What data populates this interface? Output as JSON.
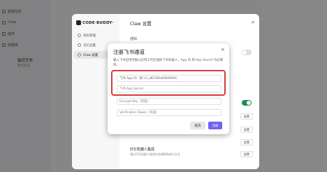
{
  "app_sidebar": {
    "items": [
      {
        "label": "新建任务",
        "icon": "new-task-icon"
      },
      {
        "label": "Claw",
        "icon": "claw-icon"
      },
      {
        "label": "插件",
        "icon": "plugin-icon"
      },
      {
        "label": "技能库",
        "icon": "skills-icon"
      }
    ],
    "group_title": "最近任务",
    "group_empty": "暂无任务"
  },
  "settings": {
    "logo": "CODE·BUDDY·",
    "title": "Claw 设置",
    "close": "×",
    "nav": [
      {
        "label": "身份管理",
        "icon": "identity-icon"
      },
      {
        "label": "记忆设置",
        "icon": "memory-icon"
      },
      {
        "label": "Claw 设置",
        "icon": "claw-settings-icon"
      }
    ],
    "section_notify": "通知",
    "section_bot_title": "钉钉机器人集成",
    "section_bot_desc": "通过钉钉机器人接收任务通知和进行交互",
    "config_label": "配置",
    "toggles": [
      false,
      true
    ]
  },
  "dialog": {
    "title": "注册飞书通道",
    "close": "×",
    "description": "输入飞书应用凭据以启用工作区通知飞书机器人。App ID 和 App Secret 为必填项。",
    "fields": [
      {
        "value": "飞书 App ID（如 cli_a82360a69b69d4）",
        "placeholder": "飞书 App ID"
      },
      {
        "value": "",
        "placeholder": "飞书 App Secret"
      },
      {
        "value": "",
        "placeholder": "Encrypt Key（可选）"
      },
      {
        "value": "",
        "placeholder": "Verification Token（可选）"
      }
    ],
    "cancel_label": "取消",
    "save_label": "注册"
  },
  "colors": {
    "accent": "#6c63f5",
    "highlight": "#d93a3a",
    "toggle_on": "#1f8a4c"
  }
}
